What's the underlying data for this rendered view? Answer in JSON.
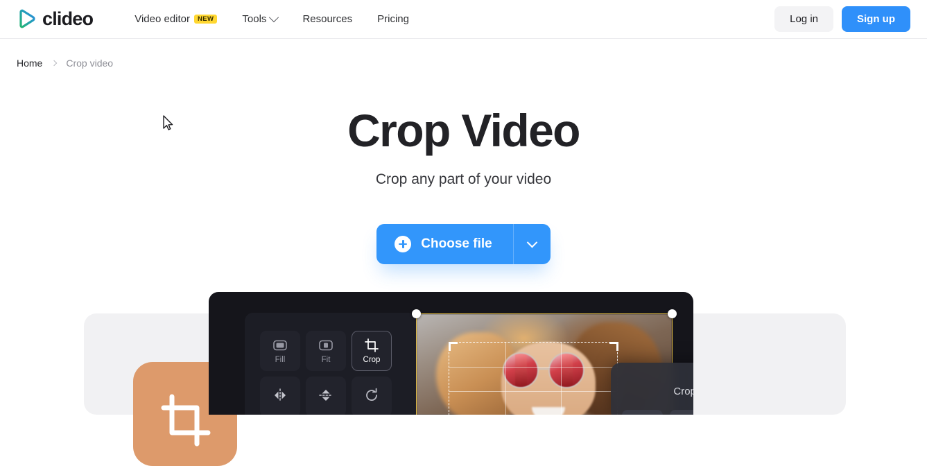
{
  "header": {
    "logo": {
      "name": "clideo-logo",
      "text": "clideo"
    },
    "nav": [
      {
        "label": "Video editor",
        "badge": "NEW",
        "has_caret": false
      },
      {
        "label": "Tools",
        "badge": null,
        "has_caret": true
      },
      {
        "label": "Resources",
        "badge": null,
        "has_caret": false
      },
      {
        "label": "Pricing",
        "badge": null,
        "has_caret": false
      }
    ],
    "login_label": "Log in",
    "signup_label": "Sign up"
  },
  "breadcrumb": {
    "home": "Home",
    "current": "Crop video"
  },
  "hero": {
    "title": "Crop Video",
    "subtitle": "Crop any part of your video"
  },
  "cta": {
    "label": "Choose file"
  },
  "showcase": {
    "editor": {
      "tools": [
        {
          "label": "Fill",
          "icon": "fill-icon",
          "selected": false
        },
        {
          "label": "Fit",
          "icon": "fit-icon",
          "selected": false
        },
        {
          "label": "Crop",
          "icon": "crop-icon",
          "selected": true
        },
        {
          "label": "",
          "icon": "flip-horizontal-icon",
          "selected": false
        },
        {
          "label": "",
          "icon": "flip-vertical-icon",
          "selected": false
        },
        {
          "label": "",
          "icon": "rotate-icon",
          "selected": false
        }
      ],
      "crop_to_title": "Crop to"
    }
  },
  "colors": {
    "accent_blue": "#3296fb",
    "badge_yellow": "#ffd731",
    "selection_yellow": "#e0bb42",
    "editor_dark": "#15151b",
    "card_grey": "#f1f1f3",
    "tile_orange": "#dd9a6b"
  }
}
